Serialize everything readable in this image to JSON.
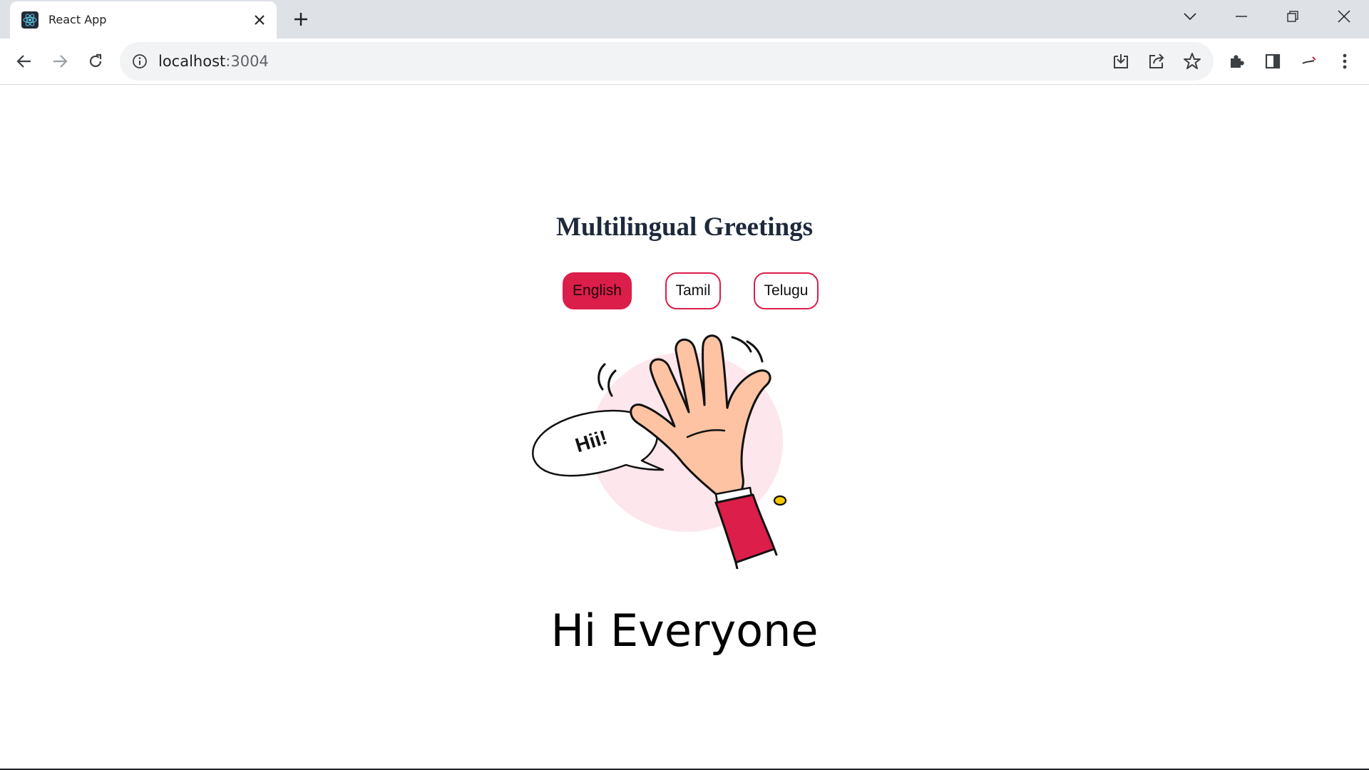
{
  "browser": {
    "tab_title": "React App",
    "url_host": "localhost",
    "url_port": ":3004"
  },
  "page": {
    "heading": "Multilingual Greetings",
    "languages": [
      {
        "label": "English",
        "active": true
      },
      {
        "label": "Tamil",
        "active": false
      },
      {
        "label": "Telugu",
        "active": false
      }
    ],
    "illustration": {
      "speech_bubble_text": "Hii!"
    },
    "greeting": "Hi Everyone"
  },
  "colors": {
    "accent": "#dc1e4a",
    "heading": "#1e293b",
    "tabstrip": "#dee1e6",
    "omnibox": "#f1f3f4"
  },
  "icons": {
    "favicon": "react-icon",
    "tab_close": "close-icon",
    "new_tab": "plus-icon",
    "tab_search": "chevron-down-icon",
    "minimize": "minimize-icon",
    "restore": "restore-icon",
    "close_window": "close-icon",
    "back": "arrow-left-icon",
    "forward": "arrow-right-icon",
    "reload": "reload-icon",
    "site_info": "info-icon",
    "install": "install-icon",
    "share": "share-icon",
    "bookmark": "star-icon",
    "extensions": "puzzle-icon",
    "side_panel": "side-panel-icon",
    "profile": "avatar",
    "menu": "more-vert-icon"
  }
}
